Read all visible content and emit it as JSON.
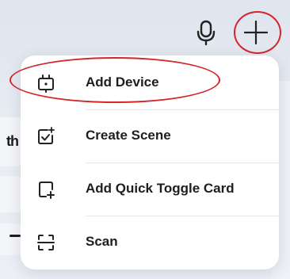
{
  "menu": {
    "items": [
      {
        "label": "Add Device",
        "icon": "add-device-icon"
      },
      {
        "label": "Create Scene",
        "icon": "create-scene-icon"
      },
      {
        "label": "Add Quick Toggle Card",
        "icon": "quick-toggle-card-icon"
      },
      {
        "label": "Scan",
        "icon": "scan-icon"
      }
    ]
  },
  "toolbar": {
    "mic_icon": "microphone-icon",
    "add_icon": "plus-icon"
  },
  "background": {
    "fragment_text": "th"
  },
  "colors": {
    "annotation": "#d4252b",
    "text": "#1d1d22",
    "menu_bg": "#ffffff"
  }
}
